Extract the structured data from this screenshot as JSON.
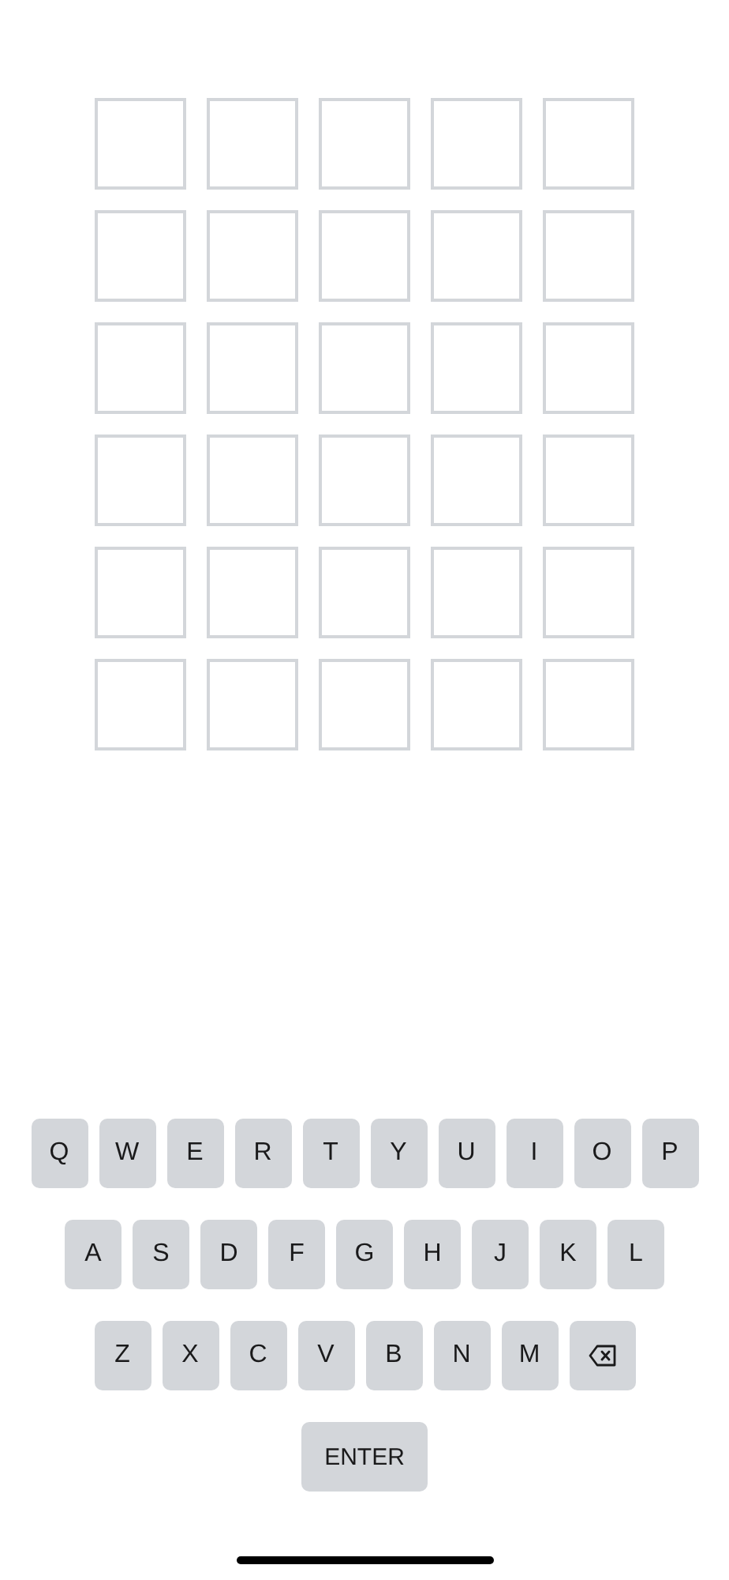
{
  "board": [
    {
      "tiles": [
        {
          "kind": "empty"
        },
        {
          "kind": "empty"
        },
        {
          "kind": "empty"
        },
        {
          "kind": "empty"
        },
        {
          "kind": "empty"
        }
      ]
    },
    {
      "tiles": [
        {
          "kind": "empty"
        },
        {
          "kind": "empty"
        },
        {
          "kind": "empty"
        },
        {
          "kind": "empty"
        },
        {
          "kind": "empty"
        }
      ]
    },
    {
      "tiles": [
        {
          "kind": "empty"
        },
        {
          "kind": "empty"
        },
        {
          "kind": "empty"
        },
        {
          "kind": "empty"
        },
        {
          "kind": "empty"
        }
      ]
    },
    {
      "tiles": [
        {
          "kind": "empty"
        },
        {
          "kind": "empty"
        },
        {
          "kind": "empty"
        },
        {
          "kind": "empty"
        },
        {
          "kind": "empty"
        }
      ]
    },
    {
      "tiles": [
        {
          "kind": "empty"
        },
        {
          "kind": "empty"
        },
        {
          "kind": "empty"
        },
        {
          "kind": "empty"
        },
        {
          "kind": "empty"
        }
      ]
    },
    {
      "tiles": [
        {
          "kind": "empty"
        },
        {
          "kind": "empty"
        },
        {
          "kind": "empty"
        },
        {
          "kind": "empty"
        },
        {
          "kind": "empty"
        }
      ]
    }
  ],
  "keyboard": [
    {
      "keys": [
        {
          "kind": "letter",
          "label": "Q"
        },
        {
          "kind": "letter",
          "label": "W"
        },
        {
          "kind": "letter",
          "label": "E"
        },
        {
          "kind": "letter",
          "label": "R"
        },
        {
          "kind": "letter",
          "label": "T"
        },
        {
          "kind": "letter",
          "label": "Y"
        },
        {
          "kind": "letter",
          "label": "U"
        },
        {
          "kind": "letter",
          "label": "I"
        },
        {
          "kind": "letter",
          "label": "O"
        },
        {
          "kind": "letter",
          "label": "P"
        }
      ]
    },
    {
      "keys": [
        {
          "kind": "letter",
          "label": "A"
        },
        {
          "kind": "letter",
          "label": "S"
        },
        {
          "kind": "letter",
          "label": "D"
        },
        {
          "kind": "letter",
          "label": "F"
        },
        {
          "kind": "letter",
          "label": "G"
        },
        {
          "kind": "letter",
          "label": "H"
        },
        {
          "kind": "letter",
          "label": "J"
        },
        {
          "kind": "letter",
          "label": "K"
        },
        {
          "kind": "letter",
          "label": "L"
        }
      ]
    },
    {
      "keys": [
        {
          "kind": "letter",
          "label": "Z"
        },
        {
          "kind": "letter",
          "label": "X"
        },
        {
          "kind": "letter",
          "label": "C"
        },
        {
          "kind": "letter",
          "label": "V"
        },
        {
          "kind": "letter",
          "label": "B"
        },
        {
          "kind": "letter",
          "label": "N"
        },
        {
          "kind": "letter",
          "label": "M"
        },
        {
          "kind": "backspace"
        }
      ]
    },
    {
      "keys": [
        {
          "kind": "enter",
          "label": "ENTER"
        }
      ]
    }
  ]
}
